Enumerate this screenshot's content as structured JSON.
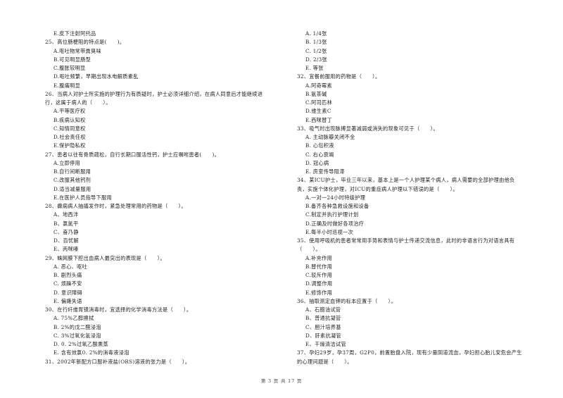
{
  "left_column": [
    {
      "type": "opt",
      "text": "E.皮下注射阿托品"
    },
    {
      "type": "q",
      "text": "25、高位肠梗阻的特点是(　　)。"
    },
    {
      "type": "opt",
      "text": "A.呕吐物常带粪臭味"
    },
    {
      "type": "opt",
      "text": "B.可见明显肠型"
    },
    {
      "type": "opt",
      "text": "C.腹胀较明显"
    },
    {
      "type": "opt",
      "text": "D.呕吐频繁，早期出现水电解质紊乱"
    },
    {
      "type": "opt",
      "text": "E.腹痛明显"
    },
    {
      "type": "q",
      "text": "26、当病人对护士所实施的护理行为有质疑时，护士必须详细介绍，在病人同意后才能继续进"
    },
    {
      "type": "cont",
      "text": "行，这属于病人的（　　）。"
    },
    {
      "type": "opt",
      "text": "A.平等医疗权"
    },
    {
      "type": "opt",
      "text": "B.疾病认知权"
    },
    {
      "type": "opt",
      "text": "C.知情同意权"
    },
    {
      "type": "opt",
      "text": "D.社会责任权"
    },
    {
      "type": "opt",
      "text": "E.保护隐私权"
    },
    {
      "type": "q",
      "text": "27、患者以往有骨质疏松，自行长期口服活性钙，护士应嘱咐患者(　　)。"
    },
    {
      "type": "opt",
      "text": "A.立即停用"
    },
    {
      "type": "opt",
      "text": "B.自行间断服用"
    },
    {
      "type": "opt",
      "text": "C.改服其他钙剂"
    },
    {
      "type": "opt",
      "text": "D.适当减量服用"
    },
    {
      "type": "opt",
      "text": "E.在医护人员指导下服用"
    },
    {
      "type": "q",
      "text": "28、癫痫病人抽搐发作时，紧急处理常用的药物是（　　）。"
    },
    {
      "type": "opt",
      "text": "A、地西泮"
    },
    {
      "type": "opt",
      "text": "B、氯氮平"
    },
    {
      "type": "opt",
      "text": "C、奋乃静"
    },
    {
      "type": "opt",
      "text": "D、百忧解"
    },
    {
      "type": "opt",
      "text": "E、丙咪嗪"
    },
    {
      "type": "q",
      "text": "29、蛛网膜下腔出血病人最突出的表现是（　　）。"
    },
    {
      "type": "opt",
      "text": "A. 恶心、呕吐"
    },
    {
      "type": "opt",
      "text": "B. 剧烈头痛"
    },
    {
      "type": "opt",
      "text": "C. 烦躁不安"
    },
    {
      "type": "opt",
      "text": "D. 意识障碍"
    },
    {
      "type": "opt",
      "text": "E. 偏瘫失语"
    },
    {
      "type": "q",
      "text": "30、在行纤维胃镜消毒时，宜选择的化学消毒方法是（　　）。"
    },
    {
      "type": "opt",
      "text": "A. 75%乙醇擦拭"
    },
    {
      "type": "opt",
      "text": "B. 2%的戊二醛浸泡"
    },
    {
      "type": "opt",
      "text": "C. 3%过氧化氢浸泡"
    },
    {
      "type": "opt",
      "text": "D. 0. 2%过氧乙酸熏蒸"
    },
    {
      "type": "opt",
      "text": "E. 含有效氯0. 2%的消毒液浸泡"
    },
    {
      "type": "q",
      "text": "31、2002年新配方口服补液盐(ORS)溶液的张力是（　　）。"
    }
  ],
  "right_column": [
    {
      "type": "opt",
      "text": "A. 1/4张"
    },
    {
      "type": "opt",
      "text": "B. 1/3张"
    },
    {
      "type": "opt",
      "text": "C. 1/2张"
    },
    {
      "type": "opt",
      "text": "D. 2/3张"
    },
    {
      "type": "opt",
      "text": "E. 等张"
    },
    {
      "type": "q",
      "text": "32、宜餐前服用的药物是（　　）。"
    },
    {
      "type": "opt",
      "text": "A.阿奇霉素"
    },
    {
      "type": "opt",
      "text": "B.氨茶碱"
    },
    {
      "type": "opt",
      "text": "C.阿司匹林"
    },
    {
      "type": "opt",
      "text": "D.维生素C"
    },
    {
      "type": "opt",
      "text": "E.西咪替丁"
    },
    {
      "type": "q",
      "text": "33、吸气时出现脉搏显著减弱或消失的现象可见于（　　）。"
    },
    {
      "type": "opt",
      "text": "A. 主动脉瓣关闭不全"
    },
    {
      "type": "opt",
      "text": "B. 心包积液"
    },
    {
      "type": "opt",
      "text": "C. 右心衰竭"
    },
    {
      "type": "opt",
      "text": "D. 冠心病"
    },
    {
      "type": "opt",
      "text": "E. 房室传导阻滞"
    },
    {
      "type": "q",
      "text": "34、某ICU护士，毕业三年以来，基本上是一个人护理某个病人，病人需要的全部护理由他负"
    },
    {
      "type": "cont",
      "text": "责，实施个体化护理，对ICU的重症病人护理以下错误的是（　　）。"
    },
    {
      "type": "opt",
      "text": "A.一对一24小时特级护理"
    },
    {
      "type": "opt",
      "text": "B.备齐各种急救设施和设备"
    },
    {
      "type": "opt",
      "text": "C.制定并执行护理计划"
    },
    {
      "type": "opt",
      "text": "D.正确及时做好各项治疗"
    },
    {
      "type": "opt",
      "text": "E.每半小时巡视一次"
    },
    {
      "type": "q",
      "text": "35、使用呼吸机的患者常常用手势和表情与护士传递交流信息，此时的非语言行为对语言具有"
    },
    {
      "type": "cont",
      "text": "（　　）。"
    },
    {
      "type": "opt",
      "text": "A.补充作用"
    },
    {
      "type": "opt",
      "text": "B.替代作用"
    },
    {
      "type": "opt",
      "text": "C.驳斥作用"
    },
    {
      "type": "opt",
      "text": "D.调整作用"
    },
    {
      "type": "opt",
      "text": "E.修饰作用"
    },
    {
      "type": "q",
      "text": "36、抽取测定血钾的标本应置于（　　）。"
    },
    {
      "type": "opt",
      "text": "A、石腊油试管"
    },
    {
      "type": "opt",
      "text": "B、普通抗凝管"
    },
    {
      "type": "opt",
      "text": "C、胆汁培养基"
    },
    {
      "type": "opt",
      "text": "D、肝素抗凝管"
    },
    {
      "type": "opt",
      "text": "E、干燥清洁试管"
    },
    {
      "type": "q",
      "text": "37、孕妇29岁，孕37周，G2P0，前置胎盘入院，现有少量阴道流血，孕妇担心胎儿安危会产生"
    },
    {
      "type": "cont",
      "text": "的心理问题是（　　）。"
    }
  ],
  "footer": {
    "page_label": "第 3 页 共 17 页"
  }
}
